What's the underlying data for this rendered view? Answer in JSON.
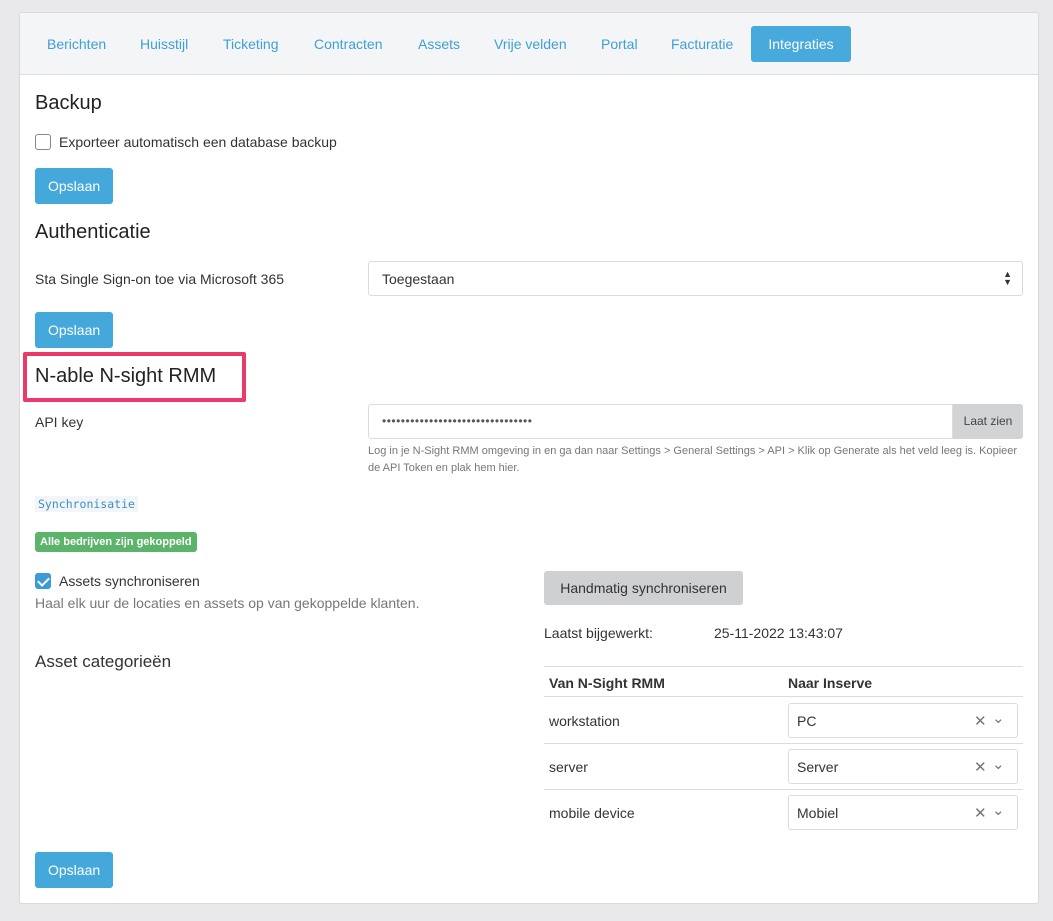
{
  "tabs": [
    "Berichten",
    "Huisstijl",
    "Ticketing",
    "Contracten",
    "Assets",
    "Vrije velden",
    "Portal",
    "Facturatie",
    "Integraties"
  ],
  "backup": {
    "title": "Backup",
    "checkbox_label": "Exporteer automatisch een database backup",
    "checked": false,
    "save_label": "Opslaan"
  },
  "auth": {
    "title": "Authenticatie",
    "sso_label": "Sta Single Sign-on toe via Microsoft 365",
    "sso_value": "Toegestaan",
    "save_label": "Opslaan"
  },
  "rmm": {
    "title": "N-able N-sight RMM",
    "api_label": "API key",
    "api_value": "••••••••••••••••••••••••••••••••",
    "show_label": "Laat zien",
    "help_text": "Log in je N-Sight RMM omgeving in en ga dan naar Settings > General Settings > API > Klik op Generate als het veld leeg is. Kopieer de API Token en plak hem hier.",
    "sync_code": "Synchronisatie",
    "badge": "Alle bedrijven zijn gekoppeld",
    "assets_sync_label": "Assets synchroniseren",
    "assets_sync_checked": true,
    "assets_sync_help": "Haal elk uur de locaties en assets op van gekoppelde klanten.",
    "manual_sync_label": "Handmatig synchroniseren",
    "last_updated_label": "Laatst bijgewerkt:",
    "last_updated_value": "25-11-2022 13:43:07",
    "categories_title": "Asset categorieën",
    "table_headers": [
      "Van N-Sight RMM",
      "Naar Inserve"
    ],
    "mappings": [
      {
        "from": "workstation",
        "to": "PC"
      },
      {
        "from": "server",
        "to": "Server"
      },
      {
        "from": "mobile device",
        "to": "Mobiel"
      }
    ],
    "save_label": "Opslaan"
  },
  "colors": {
    "accent": "#45a8db",
    "highlight": "#ea3a6a",
    "badge": "#5cb36a"
  }
}
